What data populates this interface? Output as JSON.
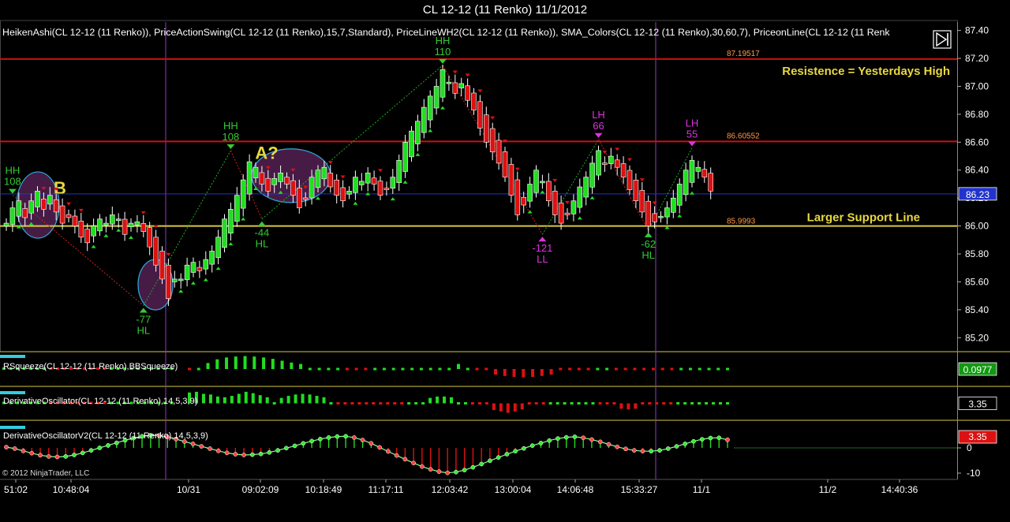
{
  "window": {
    "title": "CL 12-12 (11 Renko)  11/1/2012"
  },
  "indicator_legend": "HeikenAshi(CL 12-12 (11 Renko)), PriceActionSwing(CL 12-12 (11 Renko),15,7,Standard), PriceLineWH2(CL 12-12 (11 Renko)), SMA_Colors(CL 12-12 (11 Renko),30,60,7), PriceonLine(CL 12-12 (11 Renk",
  "copyright": "© 2012 NinjaTrader, LLC",
  "colors": {
    "bull": "#22dd22",
    "bear": "#dd1111",
    "resistance": "#cc1111",
    "support": "#d8c840",
    "current_price": "#2233cc",
    "annotation": "#e8d840",
    "hh_label": "#33cc33",
    "lh_label": "#dd33dd",
    "ellipse_fill": "#4a1e4a",
    "ellipse_stroke": "#33aadd",
    "separator": "#d8c840"
  },
  "chart_data": [
    {
      "type": "candlestick",
      "name": "price",
      "ylim": [
        85.1,
        87.46
      ],
      "y_ticks": [
        "87.40",
        "87.20",
        "87.00",
        "86.80",
        "86.60",
        "86.40",
        "86.20",
        "86.00",
        "85.80",
        "85.60",
        "85.40",
        "85.20"
      ],
      "x_ticks": [
        "51:02",
        "10:48:04",
        "10/31",
        "09:02:09",
        "10:18:49",
        "11:17:11",
        "12:03:42",
        "13:00:04",
        "14:06:48",
        "15:33:27",
        "11/1",
        "11/2",
        "14:40:36"
      ],
      "current_price": "86.23",
      "support_level": 86.0,
      "support_label_value": "85.9993",
      "support_label": "Larger Support Line",
      "resistance_levels": [
        {
          "value": 87.19517,
          "label_value": "87.19517",
          "label": "Resistence = Yesterdays High"
        },
        {
          "value": 86.60552,
          "label_value": "86.60552",
          "label": ""
        }
      ],
      "annotations": [
        "B",
        "A?"
      ],
      "swings": [
        {
          "type": "HH",
          "value": "108",
          "price": 86.22
        },
        {
          "type": "HL",
          "value": "-77",
          "price": 85.43
        },
        {
          "type": "HH",
          "value": "108",
          "price": 86.54
        },
        {
          "type": "HL",
          "value": "-44",
          "price": 86.05
        },
        {
          "type": "HH",
          "value": "110",
          "price": 87.15
        },
        {
          "type": "LL",
          "value": "-121",
          "price": 85.94
        },
        {
          "type": "LH",
          "value": "66",
          "price": 86.62
        },
        {
          "type": "HL",
          "value": "-62",
          "price": 85.97
        },
        {
          "type": "LH",
          "value": "55",
          "price": 86.56
        }
      ],
      "closes": [
        86.02,
        86.13,
        86.18,
        86.06,
        86.18,
        86.25,
        86.12,
        86.22,
        86.1,
        86.02,
        86.06,
        86.0,
        85.92,
        85.88,
        86.0,
        86.05,
        86.02,
        86.08,
        86.05,
        85.94,
        86.02,
        86.03,
        85.96,
        85.85,
        85.72,
        85.62,
        85.48,
        85.62,
        85.62,
        85.72,
        85.74,
        85.68,
        85.76,
        85.82,
        85.92,
        86.05,
        86.12,
        86.22,
        86.33,
        86.46,
        86.42,
        86.3,
        86.25,
        86.34,
        86.38,
        86.3,
        86.22,
        86.13,
        86.2,
        86.35,
        86.4,
        86.42,
        86.28,
        86.22,
        86.18,
        86.25,
        86.35,
        86.32,
        86.38,
        86.3,
        86.22,
        86.27,
        86.35,
        86.47,
        86.6,
        86.68,
        86.75,
        86.85,
        86.93,
        87.0,
        87.12,
        87.03,
        86.95,
        87.02,
        86.9,
        86.83,
        86.7,
        86.6,
        86.53,
        86.45,
        86.35,
        86.22,
        86.08,
        86.15,
        86.3,
        86.4,
        86.32,
        86.18,
        86.08,
        86.02,
        86.08,
        86.18,
        86.28,
        86.35,
        86.45,
        86.54,
        86.44,
        86.5,
        86.42,
        86.35,
        86.26,
        86.18,
        86.1,
        86.0,
        86.03,
        86.07,
        86.13,
        86.2,
        86.3,
        86.4,
        86.47,
        86.42,
        86.35,
        86.25
      ]
    },
    {
      "type": "bar",
      "name": "RSqueeze(CL 12-12 (11 Renko),BBSqueeze)",
      "current_value": "0.0977",
      "ylim": [
        -0.3,
        0.3
      ],
      "values": [
        -0.05,
        0.04,
        0.13,
        0.21,
        0.25,
        0.27,
        0.28,
        0.27,
        0.25,
        0.22,
        0.18,
        0.14,
        0.11,
        0.08,
        0.06,
        0.04,
        0.02,
        -0.02,
        -0.03,
        -0.02,
        0.02,
        0.03,
        0.05,
        0.06,
        0.07,
        0.05,
        0.06,
        0.09,
        0.1,
        0.11,
        0.08,
        -0.03,
        -0.07,
        -0.12,
        -0.15,
        -0.17,
        -0.18,
        -0.17,
        -0.15,
        -0.12,
        -0.08,
        -0.05,
        -0.03,
        -0.02,
        0.02,
        0.01,
        -0.04,
        -0.07,
        -0.1,
        -0.1,
        -0.06,
        -0.03,
        -0.02,
        0.01,
        0.02,
        0.03,
        0.03,
        0.03,
        0.03
      ]
    },
    {
      "type": "bar",
      "name": "DerivativeOscillator(CL 12-12 (11 Renko),14,5,3,9)",
      "current_value": "3.35",
      "ylim": [
        -20,
        20
      ],
      "values": [
        16,
        17,
        14,
        13,
        10,
        9,
        11,
        14,
        17,
        15,
        12,
        9,
        7,
        8,
        11,
        13,
        14,
        13,
        11,
        9,
        4,
        -3,
        -3,
        -2,
        -2,
        -1,
        -1,
        -1,
        -1,
        -2,
        -2,
        4,
        6,
        7,
        8,
        10,
        10,
        9,
        7,
        3,
        -2,
        -4,
        -7,
        -10,
        -12,
        -14,
        -12,
        -9,
        -6,
        -4,
        -2,
        2,
        3,
        5,
        6,
        7,
        5,
        3,
        -2,
        -5,
        -7,
        -8,
        -9,
        -8,
        -7,
        -5,
        -3,
        -2,
        -1,
        2,
        5,
        6,
        5,
        5,
        5,
        4,
        5
      ]
    },
    {
      "type": "bar",
      "name": "DerivativeOscillatorV2(CL 12-12 (11 Renko),14,5,3,9)",
      "current_value": "3.35",
      "y_ticks": [
        "0",
        "-10"
      ],
      "ylim": [
        -11,
        5
      ],
      "values": [
        0.3,
        -0.3,
        -1.2,
        -2.1,
        -2.9,
        -3.4,
        -3.6,
        -3.4,
        -2.8,
        -2.0,
        -1.0,
        0.0,
        1.0,
        2.0,
        3.0,
        3.9,
        4.6,
        5.0,
        4.9,
        4.3,
        3.5,
        2.5,
        1.6,
        0.6,
        -0.3,
        -1.2,
        -2.0,
        -2.5,
        -2.8,
        -2.7,
        -2.4,
        -1.8,
        -1.0,
        -0.1,
        0.8,
        1.8,
        2.7,
        3.5,
        4.1,
        4.5,
        4.6,
        4.1,
        3.1,
        1.8,
        0.2,
        -1.4,
        -3.0,
        -4.5,
        -6.0,
        -7.4,
        -8.5,
        -9.4,
        -9.9,
        -9.6,
        -8.8,
        -7.7,
        -6.4,
        -5.1,
        -3.8,
        -2.5,
        -1.3,
        -0.2,
        0.9,
        1.9,
        2.9,
        3.7,
        4.2,
        4.4,
        4.0,
        3.3,
        2.4,
        1.4,
        0.4,
        -0.4,
        -1.0,
        -1.3,
        -1.3,
        -1.0,
        -0.3,
        0.6,
        1.6,
        2.6,
        3.4,
        3.9,
        4.0,
        3.2
      ]
    }
  ]
}
